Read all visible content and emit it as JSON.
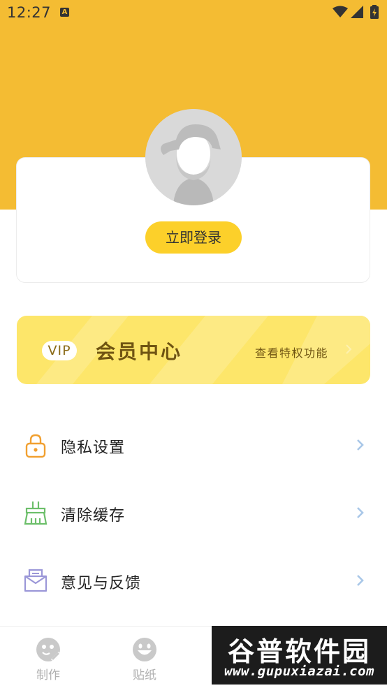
{
  "status_bar": {
    "time": "12:27",
    "notification_badge": "A"
  },
  "profile": {
    "login_button": "立即登录"
  },
  "vip": {
    "badge": "VIP",
    "title": "会员中心",
    "link": "查看特权功能"
  },
  "menu": [
    {
      "label": "隐私设置",
      "icon": "lock-icon",
      "color": "#f1a030"
    },
    {
      "label": "清除缓存",
      "icon": "broom-icon",
      "color": "#6cbf6a"
    },
    {
      "label": "意见与反馈",
      "icon": "envelope-icon",
      "color": "#9b97d8"
    }
  ],
  "tabs": [
    {
      "label": "制作",
      "icon": "face-pen-icon"
    },
    {
      "label": "贴纸",
      "icon": "smiley-icon"
    }
  ],
  "watermark": {
    "title": "谷普软件园",
    "url": "www.gupuxiazai.com"
  },
  "colors": {
    "header": "#f4bc33",
    "login_button": "#fcd02a",
    "vip_card": "#fde66a",
    "chevron": "#a9c7e8"
  }
}
